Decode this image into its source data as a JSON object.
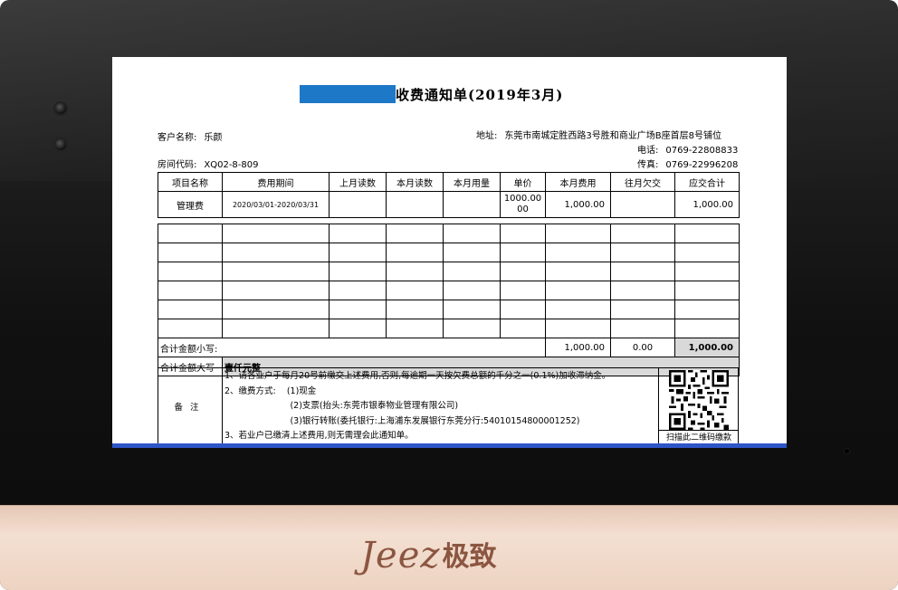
{
  "device": {
    "brand_latin": "Jeez",
    "brand_cjk": "极致"
  },
  "notice": {
    "title": "收费通知单(2019年3月)",
    "customer_label": "客户名称:",
    "customer_value": "乐颜",
    "room_label": "房间代码:",
    "room_value": "XQ02-8-809",
    "address_label": "地址:",
    "address_value": "东莞市南城定胜西路3号胜和商业广场B座首层8号铺位",
    "phone_label": "电话:",
    "phone_value": "0769-22808833",
    "fax_label": "传真:",
    "fax_value": "0769-22996208"
  },
  "table": {
    "headers": [
      "项目名称",
      "费用期间",
      "上月读数",
      "本月读数",
      "本月用量",
      "单价",
      "本月费用",
      "往月欠交",
      "应交合计"
    ],
    "rows": [
      {
        "item": "管理费",
        "period": "2020/03/01-2020/03/31",
        "last_reading": "",
        "this_reading": "",
        "usage": "",
        "unit_price": "1000.0000",
        "this_fee": "1,000.00",
        "arrears": "",
        "total": "1,000.00"
      }
    ],
    "subtotal_label": "合计金额小写:",
    "subtotal_this_fee": "1,000.00",
    "subtotal_arrears": "0.00",
    "subtotal_total": "1,000.00",
    "capital_label": "合计金额大写",
    "capital_value": "壹仟元整"
  },
  "remarks": {
    "label": "备注",
    "lines": [
      "1、请各业户于每月20号前缴交上述费用,否则,每逾期一天按欠费总额的千分之一(0.1%)加收滞纳金。",
      "2、缴费方式:    (1)现金",
      "                        (2)支票(抬头:东莞市银泰物业管理有限公司)",
      "                        (3)银行转账(委托银行:上海浦东发展银行东莞分行:54010154800001252)",
      "3、若业户已缴清上述费用,则无需理会此通知单。"
    ],
    "qr_caption": "扫描此二维码缴款",
    "qr_icon": "qr-code-icon"
  },
  "colors": {
    "redaction": "#1e78c8",
    "bezel": "#111111",
    "bottom_trim": "#efd6c6",
    "logo": "#8b5641"
  }
}
